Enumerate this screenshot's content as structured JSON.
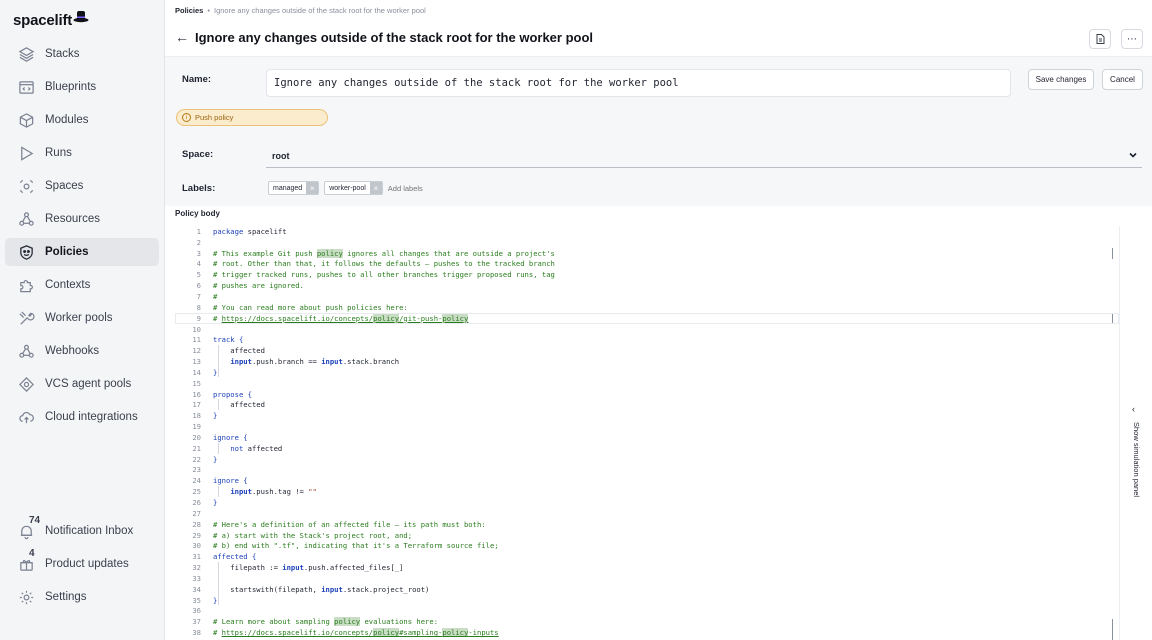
{
  "app": {
    "logo_text": "spacelift"
  },
  "sidebar": {
    "items": [
      {
        "label": "Stacks",
        "icon": "layers-icon"
      },
      {
        "label": "Blueprints",
        "icon": "blueprint-icon"
      },
      {
        "label": "Modules",
        "icon": "cube-icon"
      },
      {
        "label": "Runs",
        "icon": "play-icon"
      },
      {
        "label": "Spaces",
        "icon": "spaces-icon"
      },
      {
        "label": "Resources",
        "icon": "resources-icon"
      },
      {
        "label": "Policies",
        "icon": "policy-shield-icon",
        "active": true
      },
      {
        "label": "Contexts",
        "icon": "puzzle-icon"
      },
      {
        "label": "Worker pools",
        "icon": "wrench-icon"
      },
      {
        "label": "Webhooks",
        "icon": "webhook-icon"
      },
      {
        "label": "VCS agent pools",
        "icon": "vcs-icon"
      },
      {
        "label": "Cloud integrations",
        "icon": "cloud-icon"
      }
    ],
    "bottom": [
      {
        "label": "Notification Inbox",
        "badge": "74",
        "icon": "bell-icon"
      },
      {
        "label": "Product updates",
        "badge": "4",
        "icon": "gift-icon"
      },
      {
        "label": "Settings",
        "icon": "gear-icon"
      }
    ]
  },
  "breadcrumb": {
    "root": "Policies",
    "separator": "•",
    "current": "Ignore any changes outside of the stack root for the worker pool"
  },
  "header": {
    "title": "Ignore any changes outside of the stack root for the worker pool"
  },
  "form": {
    "name_label": "Name:",
    "name_value": "Ignore any changes outside of the stack root for the worker pool",
    "save_label": "Save changes",
    "cancel_label": "Cancel",
    "policy_type": "Push policy",
    "space_label": "Space:",
    "space_value": "root",
    "labels_label": "Labels:",
    "labels": [
      "managed",
      "worker-pool"
    ],
    "labels_placeholder": "Add labels"
  },
  "policy_body": {
    "label": "Policy body",
    "lines": [
      "package spacelift",
      "",
      "# This example Git push policy ignores all changes that are outside a project's",
      "# root. Other than that, it follows the defaults – pushes to the tracked branch",
      "# trigger tracked runs, pushes to all other branches trigger proposed runs, tag",
      "# pushes are ignored.",
      "#",
      "# You can read more about push policies here:",
      "# https://docs.spacelift.io/concepts/policy/git-push-policy",
      "",
      "track {",
      "    affected",
      "    input.push.branch == input.stack.branch",
      "}",
      "",
      "propose {",
      "    affected",
      "}",
      "",
      "ignore {",
      "    not affected",
      "}",
      "",
      "ignore {",
      "    input.push.tag != \"\"",
      "}",
      "",
      "# Here's a definition of an affected file – its path must both:",
      "# a) start with the Stack's project root, and;",
      "# b) end with \".tf\", indicating that it's a Terraform source file;",
      "affected {",
      "    filepath := input.push.affected_files[_]",
      "",
      "    startswith(filepath, input.stack.project_root)",
      "}",
      "",
      "# Learn more about sampling policy evaluations here:",
      "# https://docs.spacelift.io/concepts/policy#sampling-policy-inputs"
    ]
  },
  "simulation": {
    "label": "Show simulation panel"
  }
}
